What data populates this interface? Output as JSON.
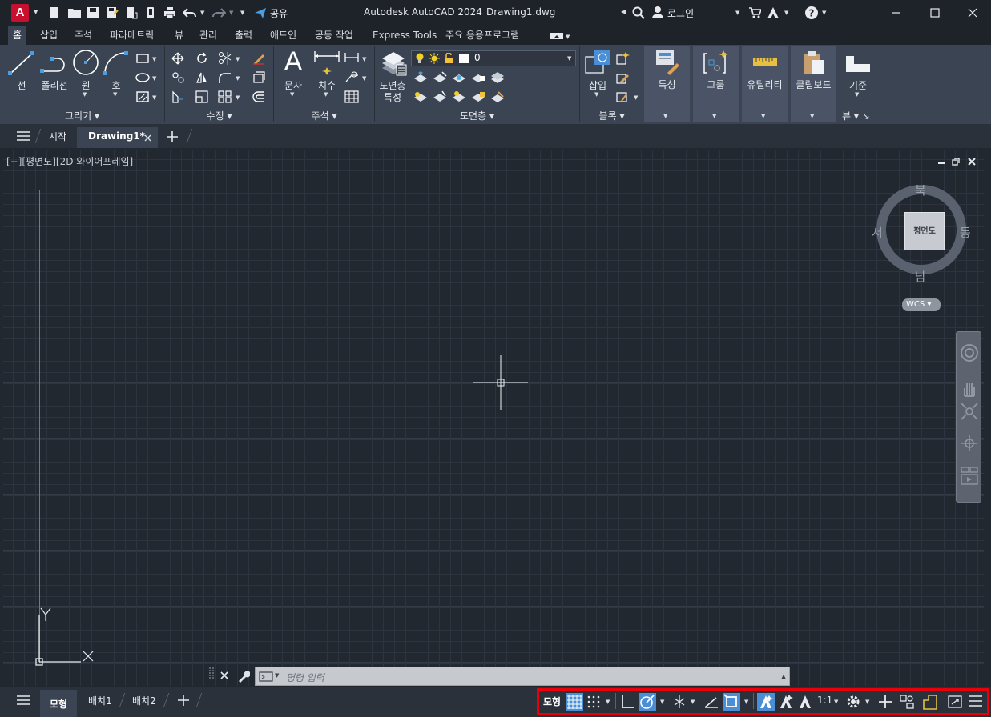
{
  "app": {
    "title": "Autodesk AutoCAD 2024",
    "filename": "Drawing1.dwg",
    "logo_letter": "A",
    "share_label": "공유",
    "login_label": "로그인",
    "colors": {
      "accent": "#4a8fd6",
      "logo": "#c8102e",
      "highlight_box": "#e8000b",
      "y_axis": "#3aa33a",
      "x_axis": "#b02a2a"
    }
  },
  "menu": {
    "tabs": [
      "홈",
      "삽입",
      "주석",
      "파라메트릭",
      "뷰",
      "관리",
      "출력",
      "애드인",
      "공동 작업",
      "Express Tools",
      "주요 응용프로그램"
    ],
    "active": "홈"
  },
  "ribbon": {
    "draw": {
      "title": "그리기",
      "line": "선",
      "polyline": "폴리선",
      "circle": "원",
      "arc": "호"
    },
    "modify": {
      "title": "수정"
    },
    "annotation": {
      "title": "주석",
      "text": "문자",
      "dimension": "치수"
    },
    "layers": {
      "title": "도면층",
      "layer_properties_line1": "도면층",
      "layer_properties_line2": "특성",
      "current_layer": "0"
    },
    "block": {
      "title": "블록",
      "insert": "삽입"
    },
    "properties": "특성",
    "groups": "그룹",
    "utilities": "유틸리티",
    "clipboard": "클립보드",
    "base": "기준",
    "view": "뷰"
  },
  "doc_tabs": {
    "start": "시작",
    "drawing": "Drawing1*"
  },
  "viewport": {
    "label": "[−][평면도][2D 와이어프레임]",
    "viewcube": {
      "top": "평면도",
      "north": "북",
      "south": "남",
      "east": "동",
      "west": "서",
      "ucs": "WCS"
    }
  },
  "command": {
    "placeholder": "명령 입력"
  },
  "layout_tabs": {
    "model": "모형",
    "layout1": "배치1",
    "layout2": "배치2"
  },
  "status": {
    "model_label": "모형",
    "scale": "1:1"
  }
}
